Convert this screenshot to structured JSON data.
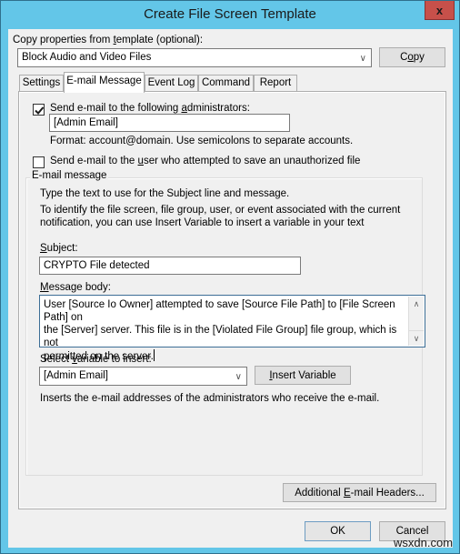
{
  "window": {
    "title": "Create File Screen Template",
    "close_label": "x"
  },
  "template": {
    "label_pre": "Copy properties from ",
    "label_accel": "t",
    "label_post": "emplate (optional):",
    "selected": "Block Audio and Video Files",
    "copy_button_pre": "C",
    "copy_button_accel": "o",
    "copy_button_post": "py"
  },
  "tabs": [
    {
      "label": "Settings",
      "active": false
    },
    {
      "label": "E-mail Message",
      "active": true
    },
    {
      "label": "Event Log",
      "active": false
    },
    {
      "label": "Command",
      "active": false
    },
    {
      "label": "Report",
      "active": false
    }
  ],
  "email": {
    "send_admins": {
      "checked": true,
      "label_pre": "Send e-mail to the following ",
      "label_accel": "a",
      "label_post": "dministrators:"
    },
    "admins_value": "[Admin Email]",
    "format_hint": "Format: account@domain. Use semicolons to separate accounts.",
    "send_user": {
      "checked": false,
      "label_pre": "Send e-mail to the ",
      "label_accel": "u",
      "label_post": "ser who attempted to save an unauthorized file"
    },
    "group_title": "E-mail message",
    "instructions_1": "Type the text to use for the Subject line and message.",
    "instructions_2a": "To identify the file screen, file group, user, or event associated with the current",
    "instructions_2b": "notification, you can use Insert Variable to insert a variable in your text",
    "subject_label_accel": "S",
    "subject_label_post": "ubject:",
    "subject_value": "CRYPTO File detected",
    "body_label_accel": "M",
    "body_label_post": "essage body:",
    "body_line_1": "User [Source Io Owner] attempted to save [Source File Path] to [File Screen Path] on",
    "body_line_2": "the [Server] server. This file is in the [Violated File Group] file group, which is not",
    "body_line_3": "permitted on the server.",
    "variable_label_pre": "Select ",
    "variable_label_accel": "v",
    "variable_label_post": "ariable to insert:",
    "variable_selected": "[Admin Email]",
    "insert_button_accel": "I",
    "insert_button_post": "nsert Variable",
    "variable_description": "Inserts the e-mail addresses of the administrators who receive the e-mail.",
    "headers_button_pre": "Additional ",
    "headers_button_accel": "E",
    "headers_button_post": "-mail Headers..."
  },
  "footer": {
    "ok_label": "OK",
    "cancel_label": "Cancel"
  },
  "watermark": "wsxdn.com"
}
